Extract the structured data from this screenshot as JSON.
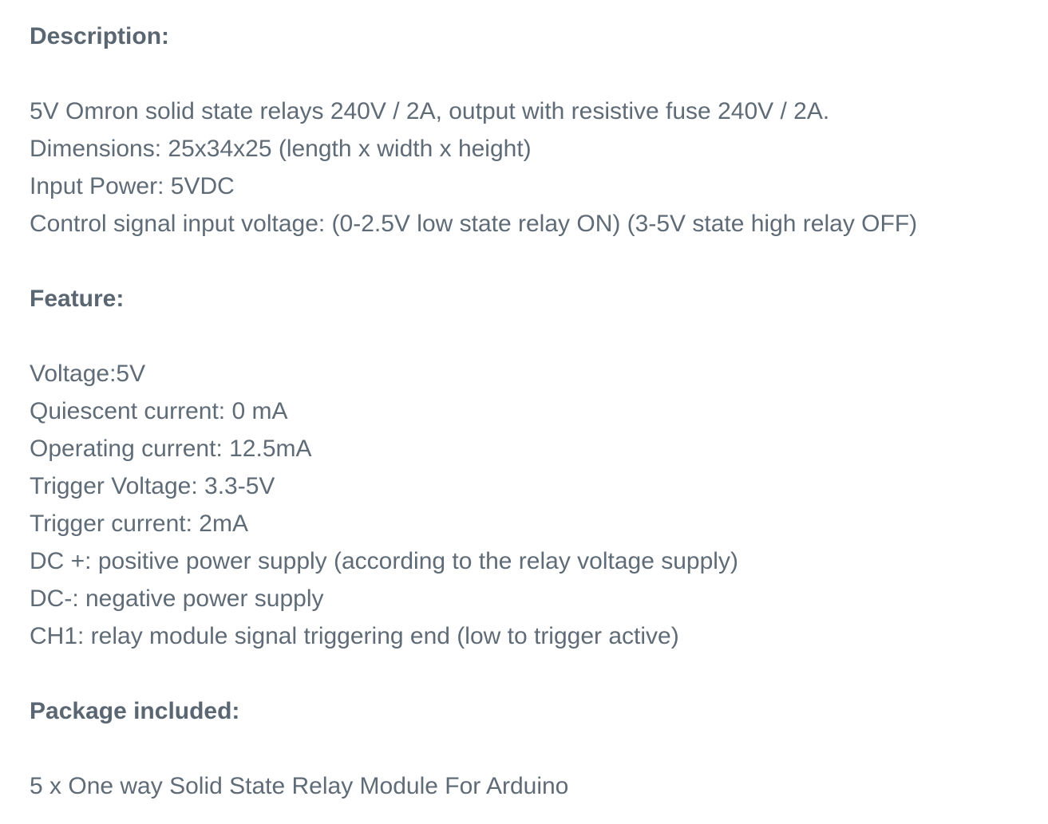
{
  "description": {
    "heading": "Description:",
    "lines": [
      "5V Omron solid state relays 240V / 2A, output with resistive fuse 240V / 2A.",
      "Dimensions: 25x34x25 (length x width x height)",
      "Input Power: 5VDC",
      "Control signal input voltage: (0-2.5V low state relay ON) (3-5V state high relay OFF)"
    ]
  },
  "feature": {
    "heading": "Feature:",
    "lines": [
      "Voltage:5V",
      "Quiescent current: 0 mA",
      "Operating current: 12.5mA",
      "Trigger Voltage: 3.3-5V",
      "Trigger current: 2mA",
      "DC +: positive power supply (according to the relay voltage supply)",
      "DC-: negative power supply",
      "CH1: relay module signal triggering end (low to trigger active)"
    ]
  },
  "package": {
    "heading": "Package included:",
    "lines": [
      "5 x One way Solid State Relay Module For Arduino"
    ]
  }
}
